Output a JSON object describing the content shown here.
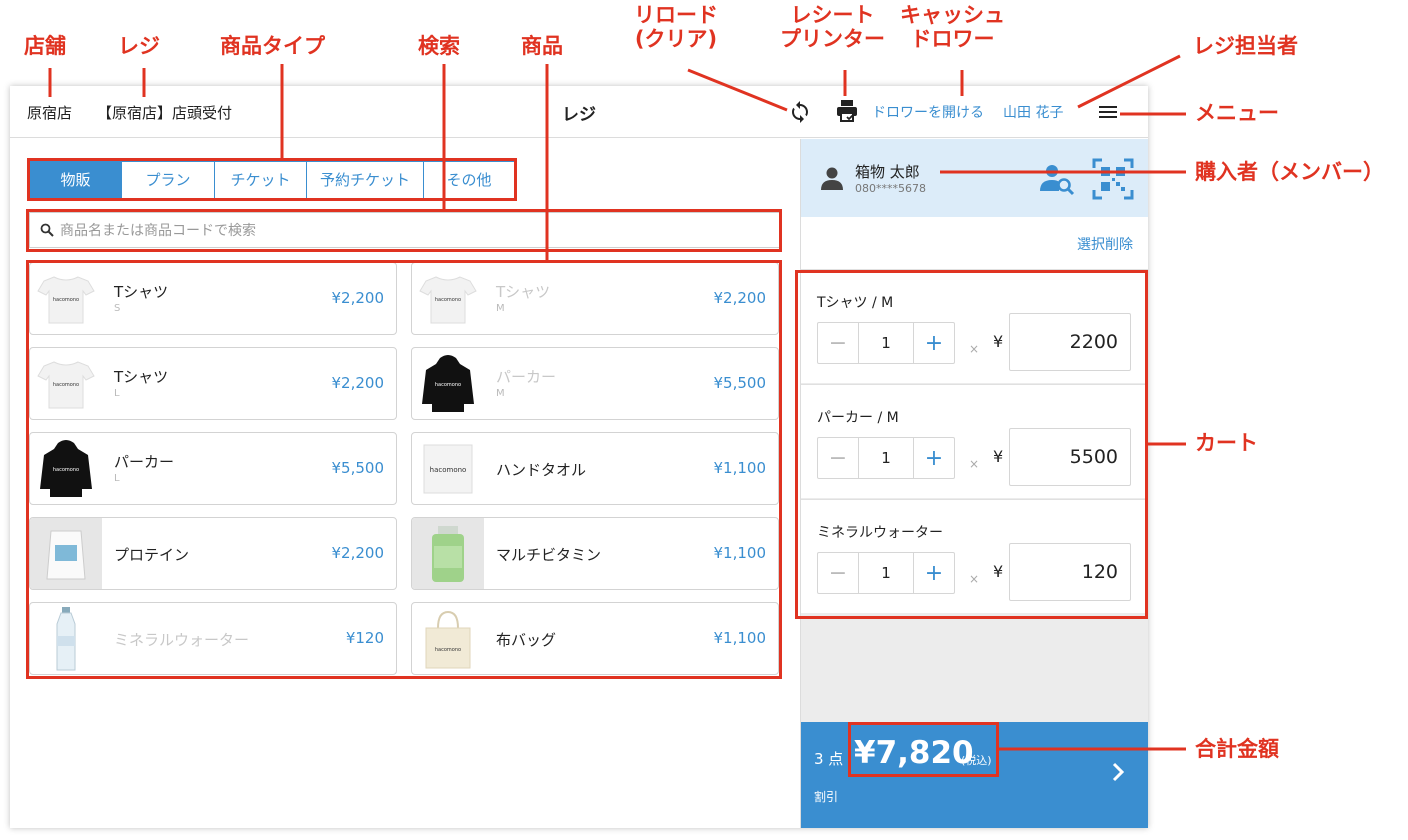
{
  "header": {
    "store": "原宿店",
    "register": "【原宿店】店頭受付",
    "title": "レジ",
    "drawer_button": "ドロワーを開ける",
    "cashier": "山田 花子",
    "icons": [
      "reload-icon",
      "receipt-printer-icon",
      "menu-icon"
    ]
  },
  "tabs": [
    {
      "label": "物販",
      "active": true
    },
    {
      "label": "プラン",
      "active": false
    },
    {
      "label": "チケット",
      "active": false
    },
    {
      "label": "予約チケット",
      "active": false
    },
    {
      "label": "その他",
      "active": false
    }
  ],
  "search": {
    "placeholder": "商品名または商品コードで検索"
  },
  "products": [
    {
      "name": "Tシャツ",
      "variant": "S",
      "price": "¥2,200",
      "image": "tshirt",
      "disabled": false
    },
    {
      "name": "Tシャツ",
      "variant": "M",
      "price": "¥2,200",
      "image": "tshirt",
      "disabled": true
    },
    {
      "name": "Tシャツ",
      "variant": "L",
      "price": "¥2,200",
      "image": "tshirt",
      "disabled": false
    },
    {
      "name": "パーカー",
      "variant": "M",
      "price": "¥5,500",
      "image": "hoodie",
      "disabled": true
    },
    {
      "name": "パーカー",
      "variant": "L",
      "price": "¥5,500",
      "image": "hoodie",
      "disabled": false
    },
    {
      "name": "ハンドタオル",
      "variant": "",
      "price": "¥1,100",
      "image": "towel",
      "disabled": false
    },
    {
      "name": "プロテイン",
      "variant": "",
      "price": "¥2,200",
      "image": "protein",
      "disabled": false
    },
    {
      "name": "マルチビタミン",
      "variant": "",
      "price": "¥1,100",
      "image": "vitamin",
      "disabled": false
    },
    {
      "name": "ミネラルウォーター",
      "variant": "",
      "price": "¥120",
      "image": "water",
      "disabled": true
    },
    {
      "name": "布バッグ",
      "variant": "",
      "price": "¥1,100",
      "image": "bag",
      "disabled": false
    }
  ],
  "buyer": {
    "name": "箱物 太郎",
    "phone": "080****5678"
  },
  "cart": {
    "clear_label": "選択削除",
    "times": "×",
    "yen": "¥",
    "items": [
      {
        "name": "Tシャツ / M",
        "qty": "1",
        "price": "2200"
      },
      {
        "name": "パーカー / M",
        "qty": "1",
        "price": "5500"
      },
      {
        "name": "ミネラルウォーター",
        "qty": "1",
        "price": "120"
      }
    ]
  },
  "total": {
    "count": "3 点",
    "amount": "¥7,820",
    "tax_note": "(税込)",
    "discount": "割引"
  },
  "annotations": {
    "store": "店舗",
    "register": "レジ",
    "product_type": "商品タイプ",
    "search": "検索",
    "products": "商品",
    "reload": "リロード\n(クリア)",
    "printer": "レシート\nプリンター",
    "drawer": "キャッシュ\nドロワー",
    "cashier": "レジ担当者",
    "menu": "メニュー",
    "buyer": "購入者（メンバー）",
    "cart": "カート",
    "total": "合計金額"
  },
  "colors": {
    "accent": "#3a8ed0",
    "annotation": "#e03321",
    "buyer_bg": "#dcecf9"
  }
}
